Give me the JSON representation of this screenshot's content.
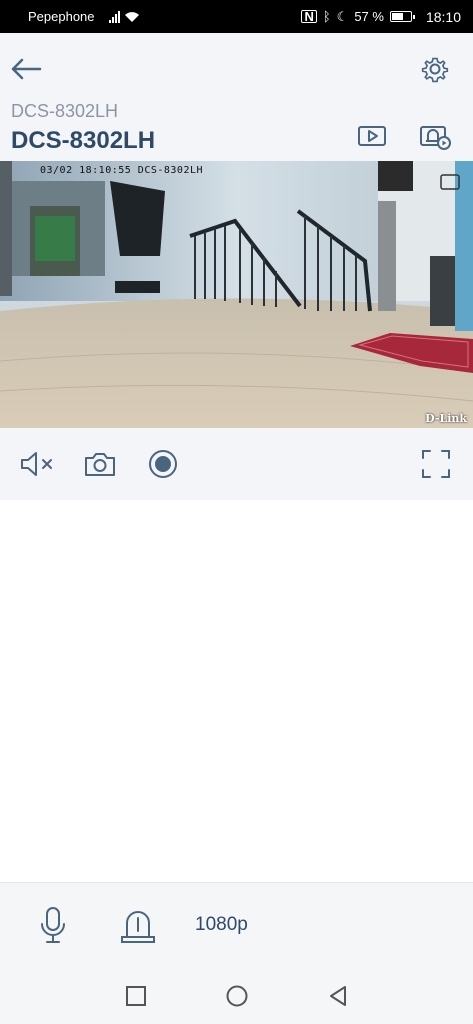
{
  "status_bar": {
    "carrier": "Pepephone",
    "battery_percent": "57 %",
    "battery_level": 0.57,
    "time": "18:10"
  },
  "header": {
    "device_model": "DCS-8302LH",
    "device_name": "DCS-8302LH",
    "icons": [
      "back-arrow-icon",
      "gear-icon",
      "playback-icon",
      "event-playback-icon"
    ]
  },
  "video": {
    "timestamp": "03/02 18:10:55 DCS-8302LH",
    "brand": "D-Link"
  },
  "controls": {
    "icons": [
      "mute-icon",
      "camera-icon",
      "record-icon",
      "fullscreen-icon"
    ]
  },
  "bottom_bar": {
    "resolution": "1080p",
    "icons": [
      "microphone-icon",
      "siren-icon"
    ]
  },
  "nav_bar": {
    "icons": [
      "recent-apps-icon",
      "home-icon",
      "back-icon"
    ]
  },
  "colors": {
    "accent": "#2e4a66",
    "icon": "#4a6580",
    "header_bg": "#f3f5f9"
  }
}
